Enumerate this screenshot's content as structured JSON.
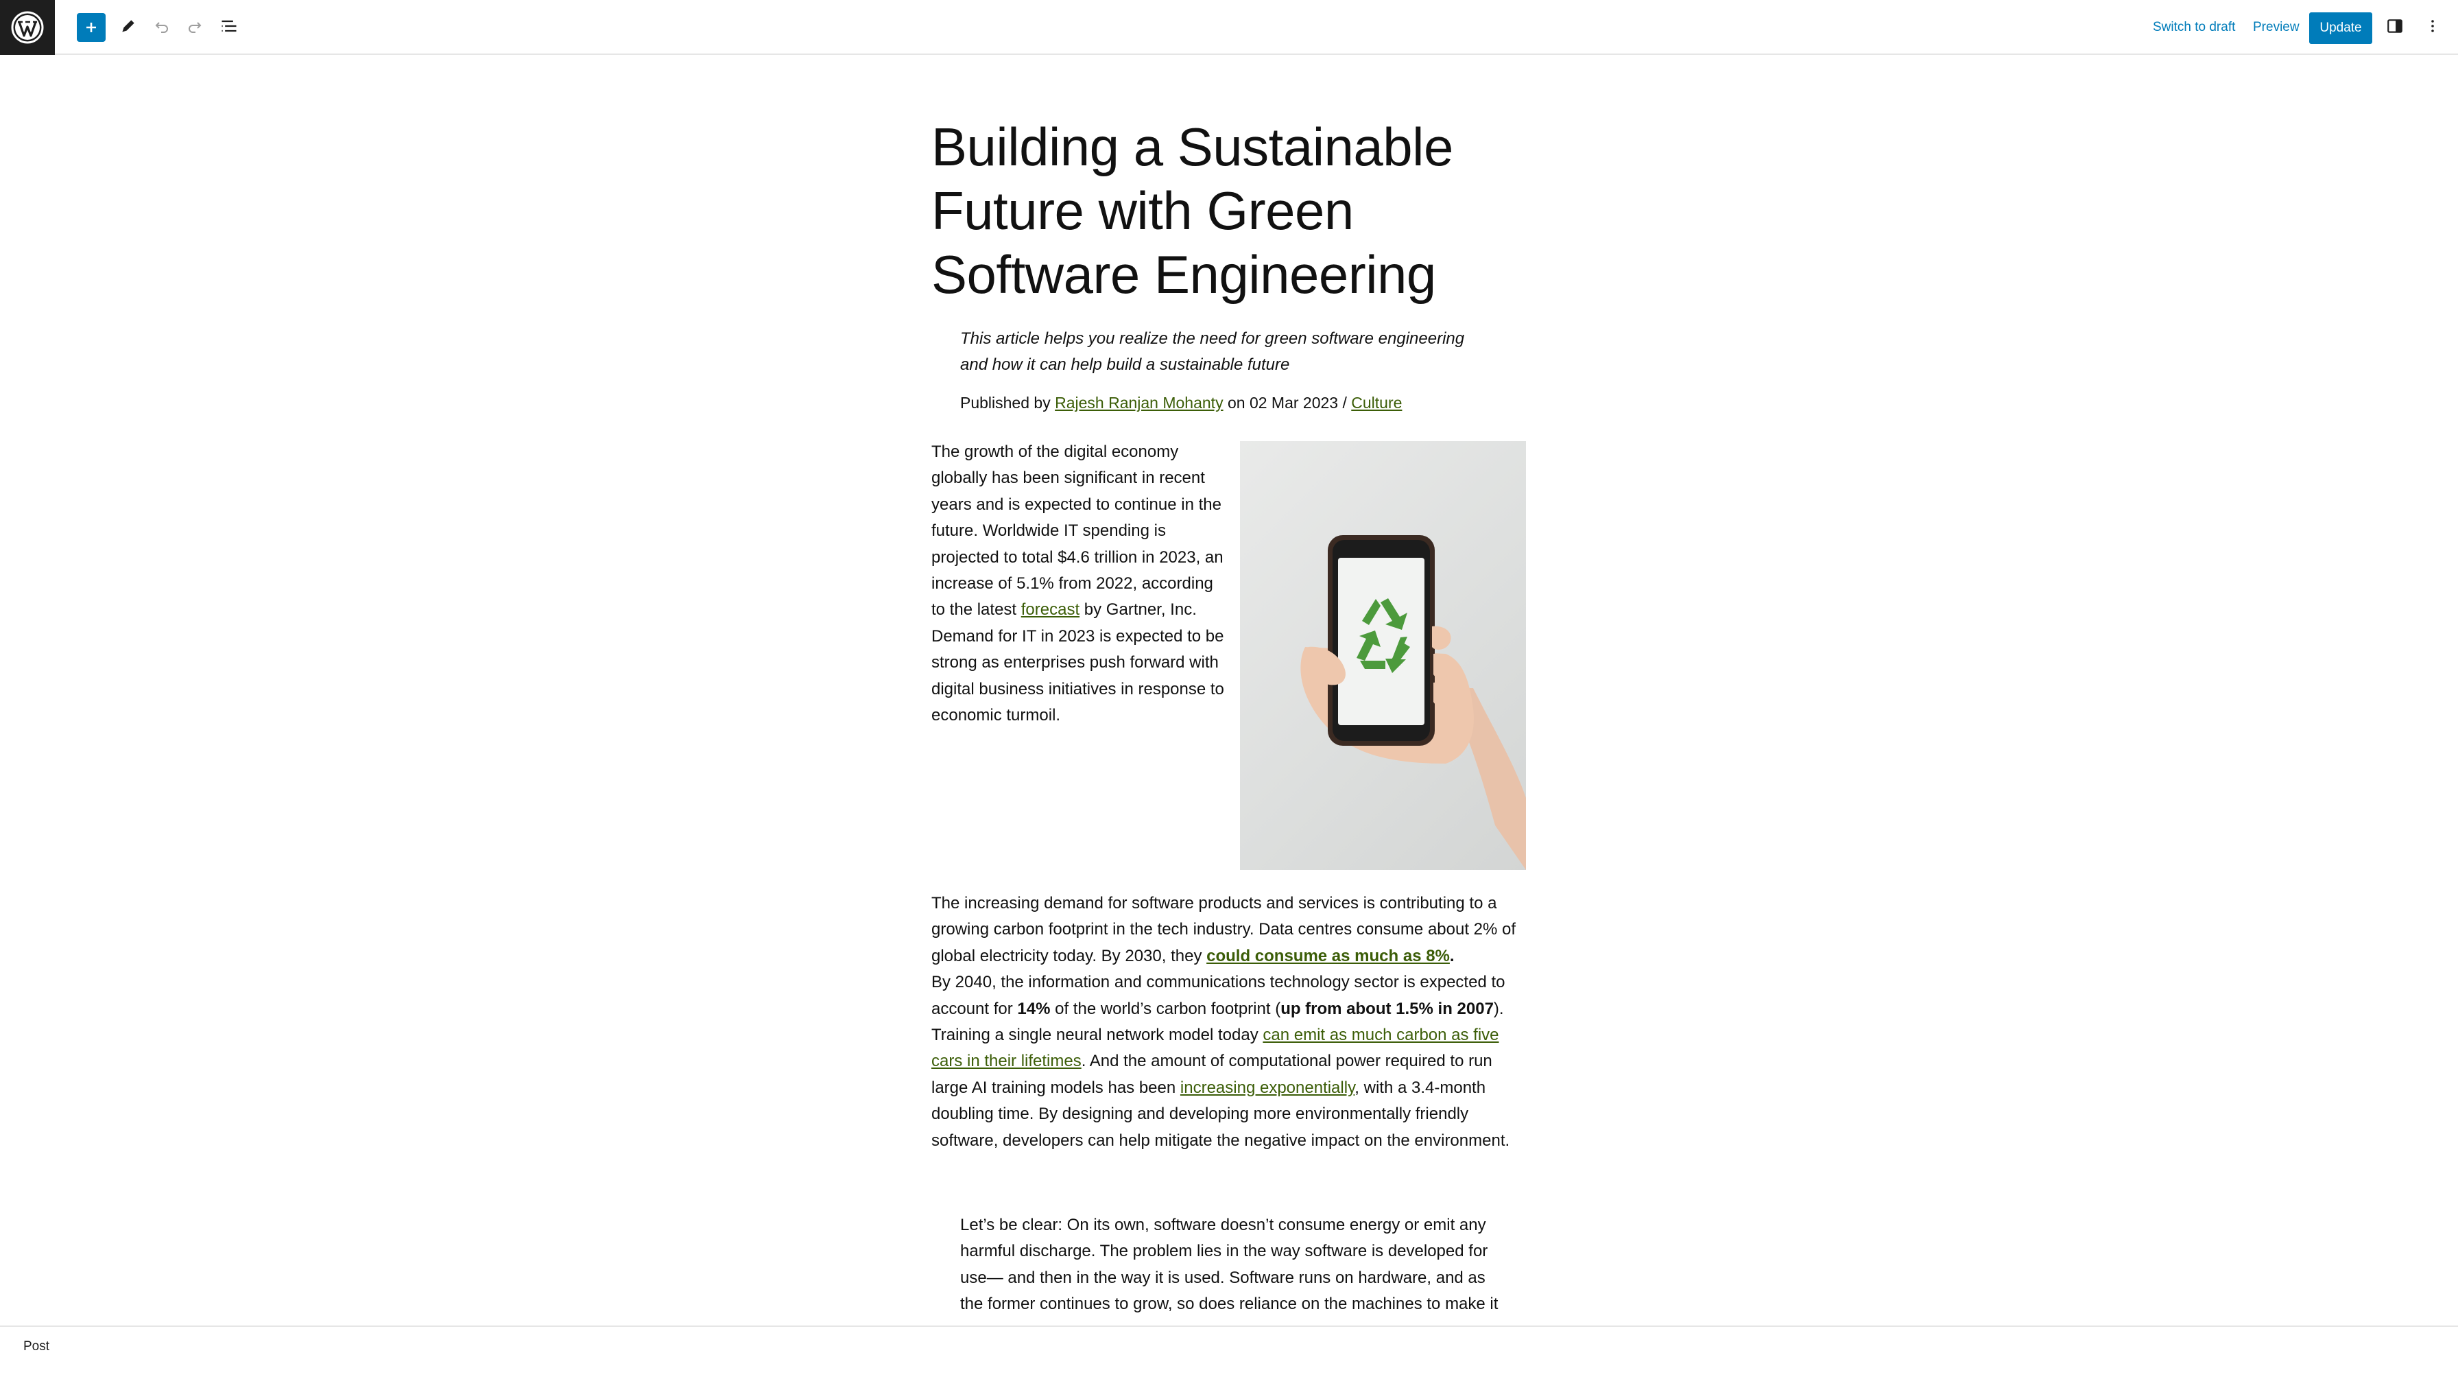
{
  "toolbar": {
    "logo": "wordpress-icon",
    "add_block": "plus-icon",
    "tools": "pencil-icon",
    "undo": "undo-icon",
    "redo": "redo-icon",
    "document_overview": "list-view-icon",
    "switch_to_draft": "Switch to draft",
    "preview": "Preview",
    "update": "Update",
    "settings": "sidebar-toggle-icon",
    "options": "more-vertical-icon",
    "accent_color": "#007cba"
  },
  "post": {
    "title": "Building a Sustainable Future with Green Software Engineering",
    "subtitle": "This article helps you realize the need for green software engineering and how it can help build a sustainable future",
    "byline": {
      "published_by": "Published by ",
      "author": "Rajesh Ranjan Mohanty",
      "on_date": " on 02 Mar 2023 / ",
      "category": "Culture"
    },
    "intro": {
      "before_link": "The growth of the digital economy globally has been significant in recent years and is expected to continue in the future. Worldwide IT spending is projected to total $4.6 trillion in 2023, an increase of 5.1% from 2022, according to the latest ",
      "link": "forecast",
      "after_link": " by Gartner, Inc. Demand for IT in 2023 is expected to be strong as enterprises push forward with digital business initiatives in response to economic turmoil."
    },
    "image_description": "hand-holding-phone-recycle-icon",
    "demand": {
      "t1": "The increasing demand for software products and services is contributing to a growing carbon footprint in the tech industry. Data centres consume about 2% of global electricity today. By 2030, they ",
      "l1": "could consume as much as 8%",
      "t2": ".",
      "t3": "By 2040, the information and communications technology sector is expected to account for ",
      "b1": "14%",
      "t4": " of the world’s carbon footprint (",
      "b2": "up from about 1.5% in 2007",
      "t5": "). Training a single neural network model today ",
      "l2": "can emit as much carbon as five cars in their lifetimes",
      "t6": ". And the amount of computational power required to run large AI training models has been ",
      "l3": "increasing exponentially",
      "t7": ", with a 3.4-month doubling time. By designing and developing more environmentally friendly software, developers can help mitigate the negative impact on the environment."
    },
    "quote": "Let’s be clear: On its own, software doesn’t consume energy or emit any harmful discharge. The problem lies in the way software is developed for use— and then in the way it is used. Software runs on hardware, and as the former continues to grow, so does reliance on the machines to make it run."
  },
  "footer": {
    "breadcrumb": "Post"
  }
}
